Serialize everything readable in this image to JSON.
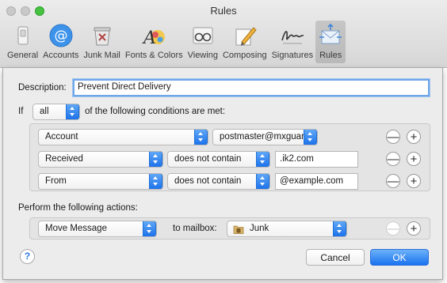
{
  "window": {
    "title": "Rules"
  },
  "toolbar": {
    "tabs": [
      {
        "label": "General",
        "icon": "switch-icon"
      },
      {
        "label": "Accounts",
        "icon": "at-sign-icon"
      },
      {
        "label": "Junk Mail",
        "icon": "trash-icon"
      },
      {
        "label": "Fonts & Colors",
        "icon": "font-palette-icon"
      },
      {
        "label": "Viewing",
        "icon": "glasses-icon"
      },
      {
        "label": "Composing",
        "icon": "pencil-paper-icon"
      },
      {
        "label": "Signatures",
        "icon": "signature-icon"
      },
      {
        "label": "Rules",
        "icon": "envelope-arrows-icon",
        "active": true
      }
    ]
  },
  "sheet": {
    "description_label": "Description:",
    "description_value": "Prevent Direct Delivery",
    "if_label": "If",
    "match_value": "all",
    "conditions_suffix": "of the following conditions are met:",
    "conditions": [
      {
        "field": "Account",
        "value": "postmaster@mxguar"
      },
      {
        "field": "Received",
        "operator": "does not contain",
        "value": ".ik2.com"
      },
      {
        "field": "From",
        "operator": "does not contain",
        "value": "@example.com"
      }
    ],
    "actions_label": "Perform the following actions:",
    "action": {
      "type": "Move Message",
      "mailbox_label": "to mailbox:",
      "mailbox": "Junk"
    },
    "remove_symbol": "—",
    "add_symbol": "+",
    "help_symbol": "?",
    "cancel_label": "Cancel",
    "ok_label": "OK"
  },
  "colors": {
    "accent": "#1d72ea",
    "focus_ring": "#6fa7e8"
  }
}
